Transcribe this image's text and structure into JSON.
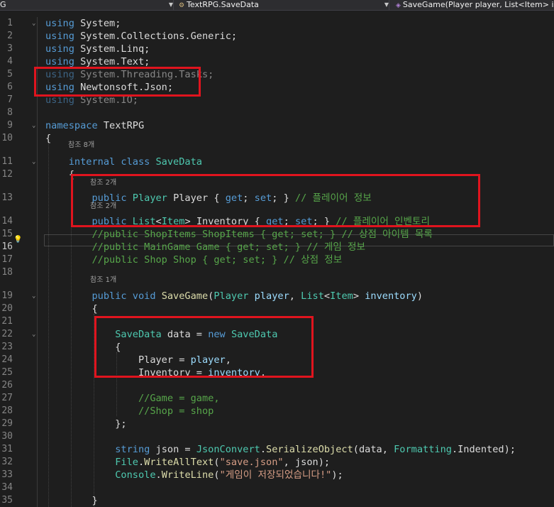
{
  "nav": {
    "project": "G",
    "class_name": "TextRPG.SaveData",
    "member": "SaveGame(Player player, List<Item> inventory)"
  },
  "lines": [
    {
      "n": "1",
      "refs": "",
      "tokens": [
        {
          "t": "using ",
          "c": "kw"
        },
        {
          "t": "System;",
          "c": "pl"
        }
      ]
    },
    {
      "n": "2",
      "refs": "",
      "tokens": [
        {
          "t": "using ",
          "c": "kw"
        },
        {
          "t": "System.Collections.Generic;",
          "c": "pl"
        }
      ]
    },
    {
      "n": "3",
      "refs": "",
      "tokens": [
        {
          "t": "using ",
          "c": "kw"
        },
        {
          "t": "System.Linq;",
          "c": "pl"
        }
      ]
    },
    {
      "n": "4",
      "refs": "",
      "tokens": [
        {
          "t": "using ",
          "c": "kw"
        },
        {
          "t": "System.Text;",
          "c": "pl"
        }
      ]
    },
    {
      "n": "5",
      "refs": "",
      "tokens": [
        {
          "t": "using ",
          "c": "kw"
        },
        {
          "t": "System.Threading.Tasks;",
          "c": "pl"
        }
      ]
    },
    {
      "n": "6",
      "refs": "",
      "tokens": [
        {
          "t": "using ",
          "c": "kw"
        },
        {
          "t": "Newtonsoft.Json;",
          "c": "pl"
        }
      ]
    },
    {
      "n": "7",
      "refs": "",
      "tokens": [
        {
          "t": "using ",
          "c": "kw"
        },
        {
          "t": "System.IO;",
          "c": "pl"
        }
      ]
    },
    {
      "n": "8",
      "refs": "",
      "tokens": []
    },
    {
      "n": "9",
      "refs": "",
      "tokens": [
        {
          "t": "namespace ",
          "c": "kw"
        },
        {
          "t": "TextRPG",
          "c": "pl"
        }
      ]
    },
    {
      "n": "10",
      "refs": "참조 8개",
      "tokens": [
        {
          "t": "{",
          "c": "pl"
        }
      ]
    },
    {
      "n": "11",
      "refs": "",
      "tokens": [
        {
          "t": "    internal class ",
          "c": "kw"
        },
        {
          "t": "SaveData",
          "c": "ty"
        }
      ]
    },
    {
      "n": "12",
      "refs": "참조 2개",
      "tokens": [
        {
          "t": "    {",
          "c": "pl"
        }
      ]
    },
    {
      "n": "13",
      "refs": "참조 2개",
      "tokens": [
        {
          "t": "        public ",
          "c": "kw"
        },
        {
          "t": "Player ",
          "c": "ty"
        },
        {
          "t": "Player { ",
          "c": "pl"
        },
        {
          "t": "get",
          "c": "kw"
        },
        {
          "t": "; ",
          "c": "pl"
        },
        {
          "t": "set",
          "c": "kw"
        },
        {
          "t": "; } ",
          "c": "pl"
        },
        {
          "t": "// 플레이어 정보",
          "c": "cm"
        }
      ]
    },
    {
      "n": "14",
      "refs": "",
      "tokens": [
        {
          "t": "        public ",
          "c": "kw"
        },
        {
          "t": "List",
          "c": "ty"
        },
        {
          "t": "<",
          "c": "pl"
        },
        {
          "t": "Item",
          "c": "ty"
        },
        {
          "t": "> Inventory { ",
          "c": "pl"
        },
        {
          "t": "get",
          "c": "kw"
        },
        {
          "t": "; ",
          "c": "pl"
        },
        {
          "t": "set",
          "c": "kw"
        },
        {
          "t": "; } ",
          "c": "pl"
        },
        {
          "t": "// 플레이어 인벤토리",
          "c": "cm"
        }
      ]
    },
    {
      "n": "15",
      "refs": "",
      "tokens": [
        {
          "t": "        //public ShopItems ShopItems { get; set; } // 상점 아이템 목록",
          "c": "cm"
        }
      ]
    },
    {
      "n": "16",
      "refs": "",
      "tokens": [
        {
          "t": "        //public MainGame Game { get; set; } // 게임 정보",
          "c": "cm"
        }
      ]
    },
    {
      "n": "17",
      "refs": "",
      "tokens": [
        {
          "t": "        //public Shop Shop { get; set; } // 상점 정보",
          "c": "cm"
        }
      ]
    },
    {
      "n": "18",
      "refs": "참조 1개",
      "tokens": []
    },
    {
      "n": "19",
      "refs": "",
      "tokens": [
        {
          "t": "        public ",
          "c": "kw"
        },
        {
          "t": "void ",
          "c": "kw"
        },
        {
          "t": "SaveGame",
          "c": "fn"
        },
        {
          "t": "(",
          "c": "pl"
        },
        {
          "t": "Player ",
          "c": "ty"
        },
        {
          "t": "player",
          "c": "pa"
        },
        {
          "t": ", ",
          "c": "pl"
        },
        {
          "t": "List",
          "c": "ty"
        },
        {
          "t": "<",
          "c": "pl"
        },
        {
          "t": "Item",
          "c": "ty"
        },
        {
          "t": "> ",
          "c": "pl"
        },
        {
          "t": "inventory",
          "c": "pa"
        },
        {
          "t": ")",
          "c": "pl"
        }
      ]
    },
    {
      "n": "20",
      "refs": "",
      "tokens": [
        {
          "t": "        {",
          "c": "pl"
        }
      ]
    },
    {
      "n": "21",
      "refs": "",
      "tokens": []
    },
    {
      "n": "22",
      "refs": "",
      "tokens": [
        {
          "t": "            ",
          "c": "pl"
        },
        {
          "t": "SaveData ",
          "c": "ty"
        },
        {
          "t": "data = ",
          "c": "pl"
        },
        {
          "t": "new ",
          "c": "kw"
        },
        {
          "t": "SaveData",
          "c": "ty"
        }
      ]
    },
    {
      "n": "23",
      "refs": "",
      "tokens": [
        {
          "t": "            {",
          "c": "pl"
        }
      ]
    },
    {
      "n": "24",
      "refs": "",
      "tokens": [
        {
          "t": "                Player = ",
          "c": "pl"
        },
        {
          "t": "player",
          "c": "pa"
        },
        {
          "t": ",",
          "c": "pl"
        }
      ]
    },
    {
      "n": "25",
      "refs": "",
      "tokens": [
        {
          "t": "                Inventory = ",
          "c": "pl"
        },
        {
          "t": "inventory",
          "c": "pa"
        },
        {
          "t": ",",
          "c": "pl"
        }
      ]
    },
    {
      "n": "26",
      "refs": "",
      "tokens": []
    },
    {
      "n": "27",
      "refs": "",
      "tokens": [
        {
          "t": "                //Game = game,",
          "c": "cm"
        }
      ]
    },
    {
      "n": "28",
      "refs": "",
      "tokens": [
        {
          "t": "                //Shop = shop",
          "c": "cm"
        }
      ]
    },
    {
      "n": "29",
      "refs": "",
      "tokens": [
        {
          "t": "            };",
          "c": "pl"
        }
      ]
    },
    {
      "n": "30",
      "refs": "",
      "tokens": []
    },
    {
      "n": "31",
      "refs": "",
      "tokens": [
        {
          "t": "            ",
          "c": "pl"
        },
        {
          "t": "string ",
          "c": "kw"
        },
        {
          "t": "json = ",
          "c": "pl"
        },
        {
          "t": "JsonConvert",
          "c": "ty"
        },
        {
          "t": ".",
          "c": "pl"
        },
        {
          "t": "SerializeObject",
          "c": "fn"
        },
        {
          "t": "(data, ",
          "c": "pl"
        },
        {
          "t": "Formatting",
          "c": "ty"
        },
        {
          "t": ".Indented);",
          "c": "pl"
        }
      ]
    },
    {
      "n": "32",
      "refs": "",
      "tokens": [
        {
          "t": "            ",
          "c": "pl"
        },
        {
          "t": "File",
          "c": "ty"
        },
        {
          "t": ".",
          "c": "pl"
        },
        {
          "t": "WriteAllText",
          "c": "fn"
        },
        {
          "t": "(",
          "c": "pl"
        },
        {
          "t": "\"save.json\"",
          "c": "st"
        },
        {
          "t": ", json);",
          "c": "pl"
        }
      ]
    },
    {
      "n": "33",
      "refs": "",
      "tokens": [
        {
          "t": "            ",
          "c": "pl"
        },
        {
          "t": "Console",
          "c": "ty"
        },
        {
          "t": ".",
          "c": "pl"
        },
        {
          "t": "WriteLine",
          "c": "fn"
        },
        {
          "t": "(",
          "c": "pl"
        },
        {
          "t": "\"게임이 저장되었습니다!\"",
          "c": "st"
        },
        {
          "t": ");",
          "c": "pl"
        }
      ]
    },
    {
      "n": "34",
      "refs": "",
      "tokens": []
    },
    {
      "n": "35",
      "refs": "",
      "tokens": [
        {
          "t": "        }",
          "c": "pl"
        }
      ]
    }
  ]
}
